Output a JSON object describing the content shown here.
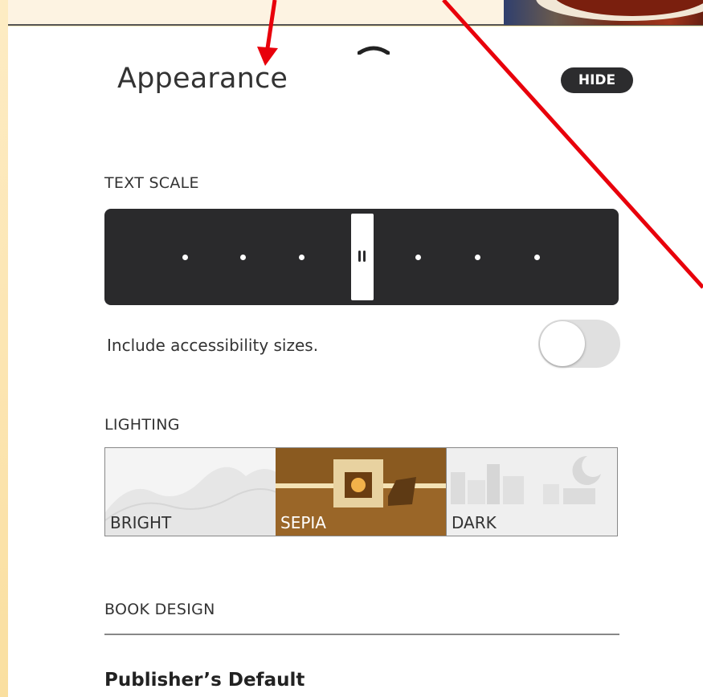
{
  "panel": {
    "title": "Appearance",
    "hide_label": "HIDE"
  },
  "text_scale": {
    "label": "TEXT SCALE",
    "steps": 7,
    "selected_step": 4,
    "accessibility_label": "Include accessibility sizes.",
    "accessibility_enabled": false
  },
  "lighting": {
    "label": "LIGHTING",
    "options": [
      "BRIGHT",
      "SEPIA",
      "DARK"
    ],
    "selected": "SEPIA"
  },
  "book_design": {
    "label": "BOOK DESIGN",
    "value": "Publisher’s Default"
  },
  "colors": {
    "annotation": "#e8000b",
    "control_dark": "#2a2a2c",
    "sepia": "#a06c2e"
  },
  "icons": {
    "collapse": "chevron-up-icon",
    "toggle_knob": "toggle-knob-icon"
  }
}
